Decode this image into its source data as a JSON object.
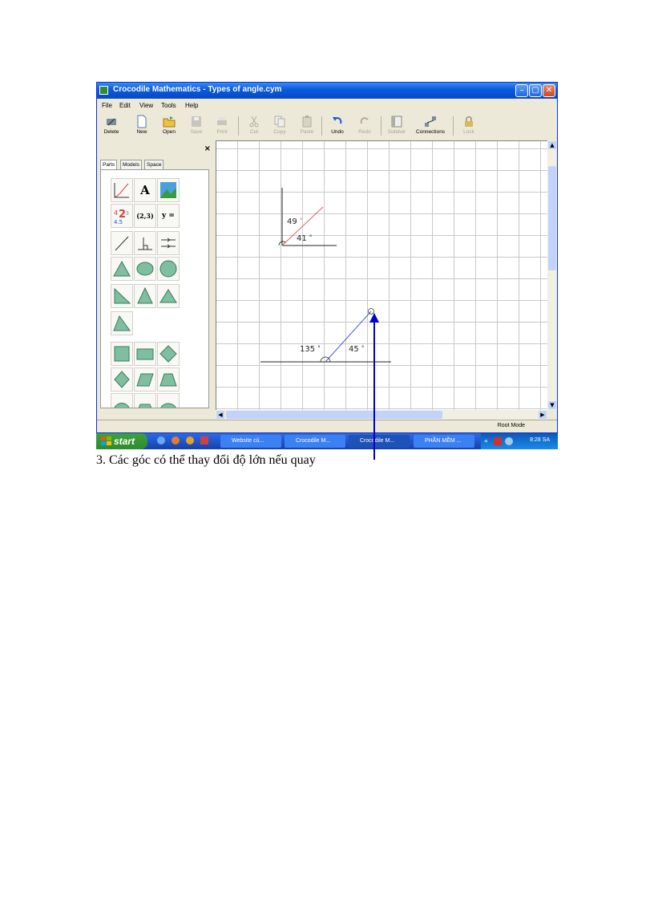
{
  "window": {
    "title": "Crocodile Mathematics - Types of angle.cym",
    "min_glyph": "–",
    "max_glyph": "▢",
    "close_glyph": "✕"
  },
  "menu": [
    "File",
    "Edit",
    "View",
    "Tools",
    "Help"
  ],
  "toolbar": {
    "delete": "Delete",
    "new": "New",
    "open": "Open",
    "save": "Save",
    "print": "Print",
    "cut": "Cut",
    "copy": "Copy",
    "paste": "Paste",
    "undo": "Undo",
    "redo": "Redo",
    "sidebar": "Sidebar",
    "connections": "Connections",
    "lock": "Lock"
  },
  "sidebar": {
    "close_glyph": "×",
    "tabs": [
      "Parts",
      "Models",
      "Space"
    ],
    "parts_text": {
      "text_tool": "A",
      "coordinate": "(2,3)",
      "equation": "y ="
    }
  },
  "canvas": {
    "angle1": {
      "a": "49",
      "b": "41",
      "unit": "°"
    },
    "angle2": {
      "a": "135",
      "b": "45",
      "unit": "°"
    }
  },
  "status": {
    "mode": "Root Mode"
  },
  "taskbar": {
    "start": "start",
    "tasks": [
      "Website củ...",
      "Crocodile M...",
      "Crocodile M...",
      "PHẦN MỀM ..."
    ],
    "clock": "8:28 SA"
  },
  "caption": "3. Các góc có thể thay đổi độ lớn nếu quay",
  "colors": {
    "accent_red": "#e06060",
    "accent_blue": "#4d5fd0",
    "arrow": "#0000cc"
  }
}
